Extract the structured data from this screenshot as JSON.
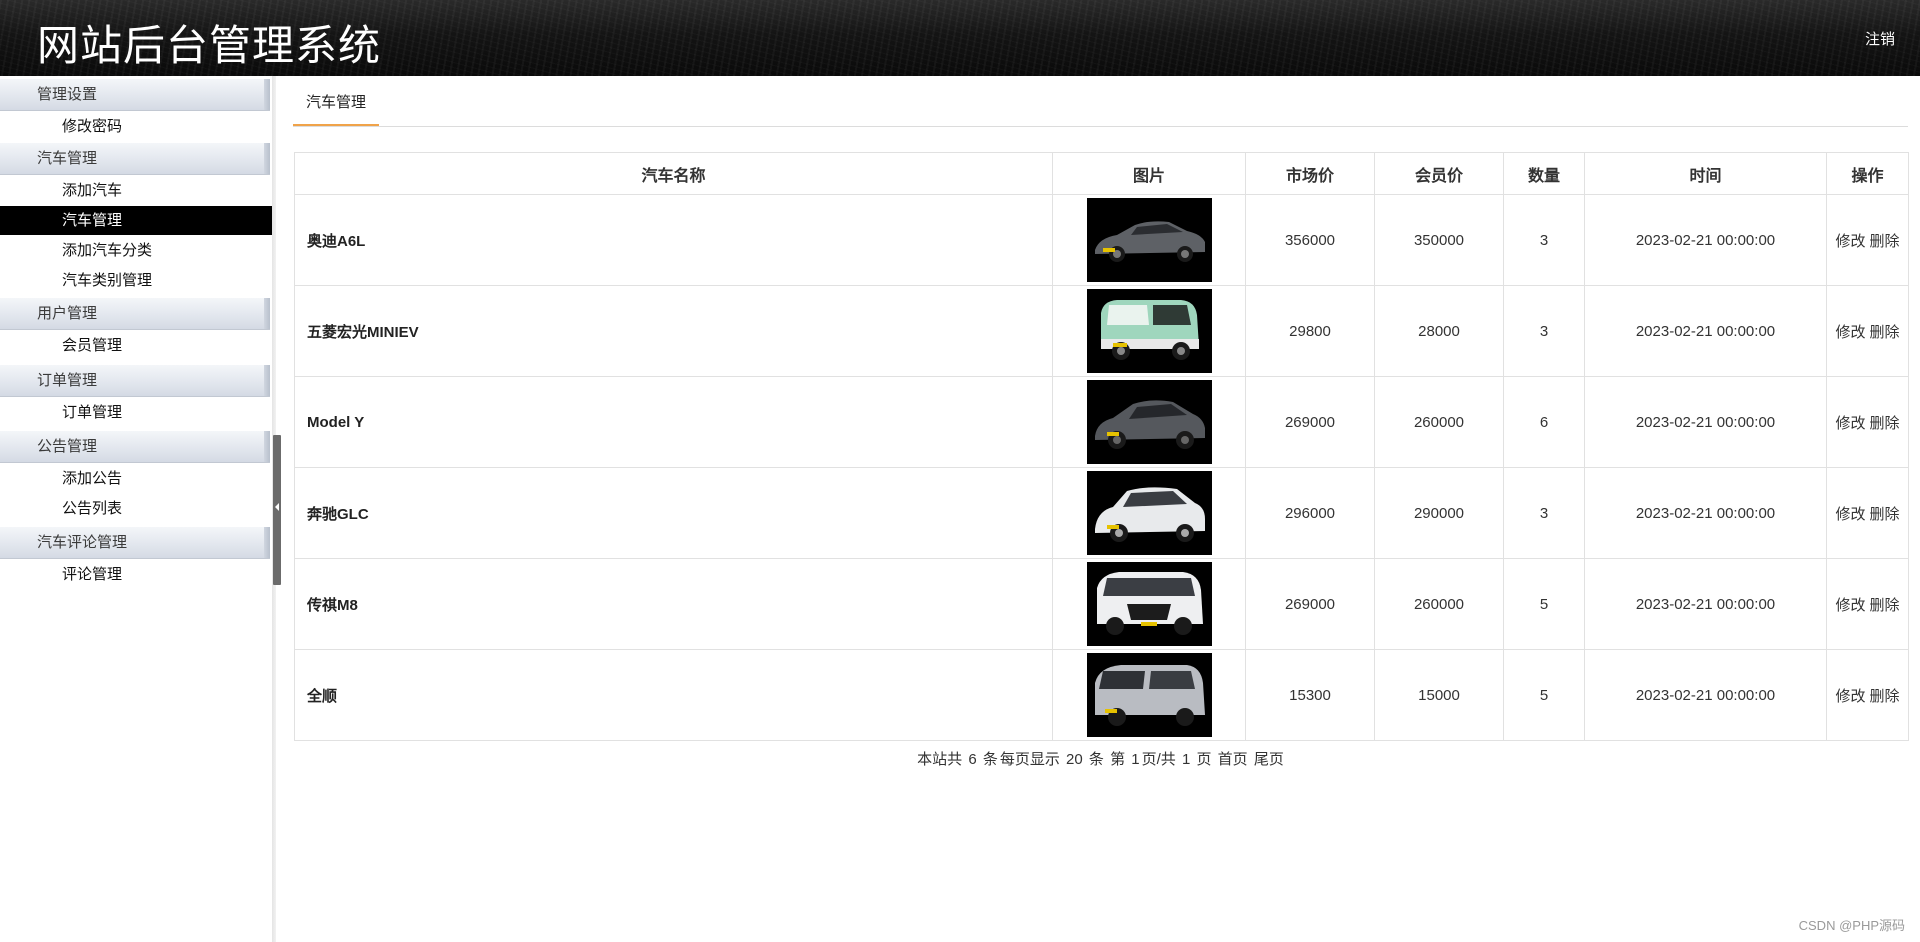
{
  "header": {
    "title": "网站后台管理系统",
    "logout_label": "注销"
  },
  "sidebar": {
    "groups": [
      {
        "title": "管理设置",
        "items": [
          {
            "label": "修改密码"
          }
        ]
      },
      {
        "title": "汽车管理",
        "items": [
          {
            "label": "添加汽车"
          },
          {
            "label": "汽车管理",
            "active": true
          },
          {
            "label": "添加汽车分类"
          },
          {
            "label": "汽车类别管理"
          }
        ]
      },
      {
        "title": "用户管理",
        "items": [
          {
            "label": "会员管理"
          }
        ]
      },
      {
        "title": "订单管理",
        "items": [
          {
            "label": "订单管理"
          }
        ]
      },
      {
        "title": "公告管理",
        "items": [
          {
            "label": "添加公告"
          },
          {
            "label": "公告列表"
          }
        ]
      },
      {
        "title": "汽车评论管理",
        "items": [
          {
            "label": "评论管理"
          }
        ]
      }
    ]
  },
  "main": {
    "tab_label": "汽车管理",
    "table": {
      "headers": [
        "汽车名称",
        "图片",
        "市场价",
        "会员价",
        "数量",
        "时间",
        "操作"
      ],
      "rows": [
        {
          "name": "奥迪A6L",
          "image": "car-sedan-dark",
          "market_price": "356000",
          "member_price": "350000",
          "quantity": "3",
          "time": "2023-02-21 00:00:00",
          "edit": "修改",
          "delete": "删除"
        },
        {
          "name": "五菱宏光MINIEV",
          "image": "car-mini-mint",
          "market_price": "29800",
          "member_price": "28000",
          "quantity": "3",
          "time": "2023-02-21 00:00:00",
          "edit": "修改",
          "delete": "删除"
        },
        {
          "name": "Model Y",
          "image": "car-suv-grey",
          "market_price": "269000",
          "member_price": "260000",
          "quantity": "6",
          "time": "2023-02-21 00:00:00",
          "edit": "修改",
          "delete": "删除"
        },
        {
          "name": "奔驰GLC",
          "image": "car-suv-white",
          "market_price": "296000",
          "member_price": "290000",
          "quantity": "3",
          "time": "2023-02-21 00:00:00",
          "edit": "修改",
          "delete": "删除"
        },
        {
          "name": "传祺M8",
          "image": "car-mpv-white",
          "market_price": "269000",
          "member_price": "260000",
          "quantity": "5",
          "time": "2023-02-21 00:00:00",
          "edit": "修改",
          "delete": "删除"
        },
        {
          "name": "全顺",
          "image": "car-van-silver",
          "market_price": "15300",
          "member_price": "15000",
          "quantity": "5",
          "time": "2023-02-21 00:00:00",
          "edit": "修改",
          "delete": "删除"
        }
      ]
    },
    "pagination": {
      "total_prefix": "本站共",
      "total": "6",
      "total_unit": "条",
      "per_page_prefix": "每页显示",
      "per_page": "20",
      "per_page_unit": "条",
      "page_prefix": "第",
      "current_page": "1",
      "page_sep": "页/共",
      "total_pages": "1",
      "page_suffix": "页",
      "first_label": "首页",
      "last_label": "尾页"
    }
  },
  "watermark": "CSDN @PHP源码",
  "colors": {
    "accent_tab": "#f0a34a",
    "active_nav": "#000000",
    "header_bg": "#141414"
  }
}
